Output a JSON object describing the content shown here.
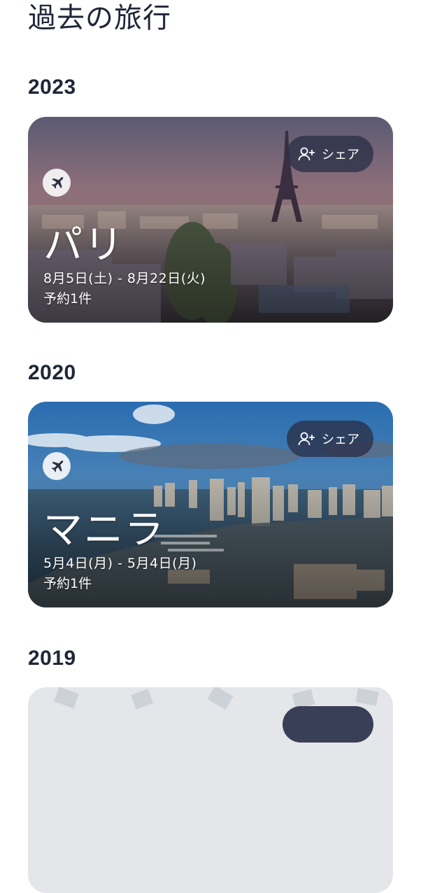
{
  "page": {
    "title": "過去の旅行"
  },
  "groups": [
    {
      "year": "2023",
      "trip": {
        "city": "パリ",
        "dates": "8月5日(土) - 8月22日(火)",
        "bookings": "予約1件",
        "share_label": "シェア",
        "icon": "airplane-icon"
      }
    },
    {
      "year": "2020",
      "trip": {
        "city": "マニラ",
        "dates": "5月4日(月) - 5月4日(月)",
        "bookings": "予約1件",
        "share_label": "シェア",
        "icon": "airplane-icon"
      }
    },
    {
      "year": "2019"
    }
  ]
}
